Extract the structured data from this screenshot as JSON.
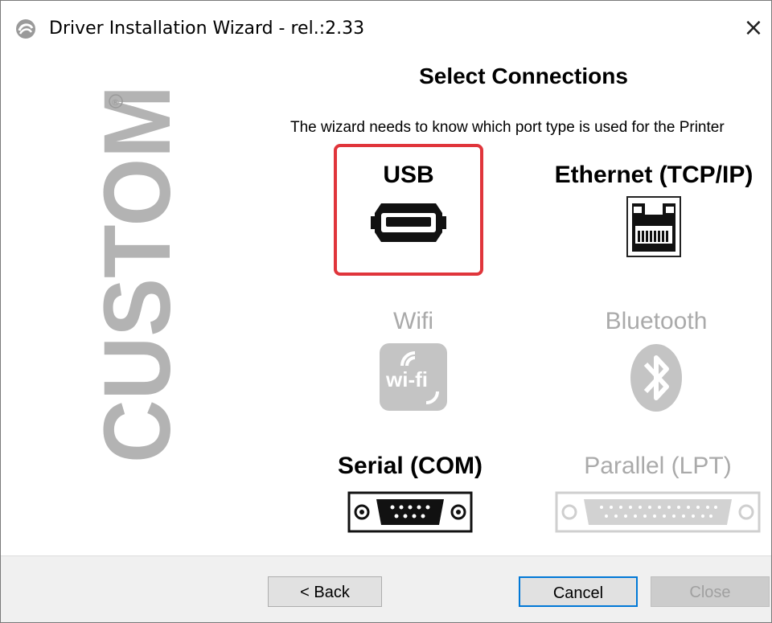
{
  "window": {
    "title": "Driver Installation Wizard - rel.:2.33",
    "close_glyph": "×"
  },
  "logo": {
    "text": "CUSTOM",
    "mark": "®"
  },
  "page": {
    "heading": "Select Connections",
    "description": "The wizard needs to know which port type is used for the Printer"
  },
  "options": [
    {
      "label": "USB",
      "icon": "usb-port-icon",
      "enabled": true,
      "selected": true
    },
    {
      "label": "Ethernet (TCP/IP)",
      "icon": "ethernet-port-icon",
      "enabled": true,
      "selected": false
    },
    {
      "label": "Wifi",
      "icon": "wifi-icon",
      "enabled": false,
      "selected": false
    },
    {
      "label": "Bluetooth",
      "icon": "bluetooth-icon",
      "enabled": false,
      "selected": false
    },
    {
      "label": "Serial (COM)",
      "icon": "serial-port-icon",
      "enabled": true,
      "selected": false
    },
    {
      "label": "Parallel (LPT)",
      "icon": "parallel-port-icon",
      "enabled": false,
      "selected": false
    }
  ],
  "buttons": {
    "back": "< Back",
    "cancel": "Cancel",
    "close": "Close"
  },
  "colors": {
    "selection_border": "#e0353b",
    "disabled_text": "#aaaaaa",
    "logo_gray": "#b3b3b3",
    "default_button_border": "#0078d7"
  }
}
